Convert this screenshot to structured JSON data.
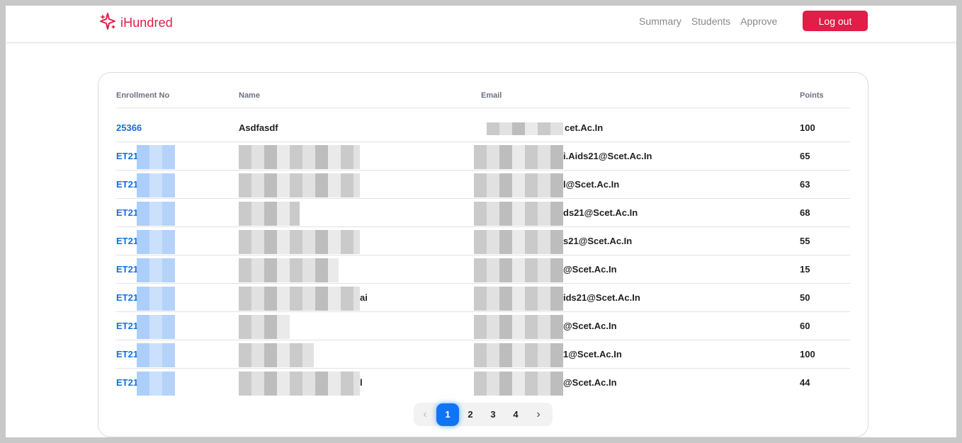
{
  "header": {
    "brand": "iHundred",
    "nav": [
      "Summary",
      "Students",
      "Approve"
    ],
    "logout_label": "Log out"
  },
  "table": {
    "headers": [
      "Enrollment No",
      "Name",
      "Email",
      "Points"
    ],
    "rows": [
      {
        "enrollment": "25366",
        "name": "Asdfasdf",
        "email": "cet.Ac.In",
        "points": "100"
      },
      {
        "enrollment": "ET21",
        "name": "",
        "email": "i.Aids21@Scet.Ac.In",
        "points": "65"
      },
      {
        "enrollment": "ET21",
        "name": "",
        "email": "l@Scet.Ac.In",
        "points": "63"
      },
      {
        "enrollment": "ET21",
        "name": "",
        "email": "ds21@Scet.Ac.In",
        "points": "68"
      },
      {
        "enrollment": "ET21",
        "name": "",
        "email": "s21@Scet.Ac.In",
        "points": "55"
      },
      {
        "enrollment": "ET21",
        "name": "",
        "email": "@Scet.Ac.In",
        "points": "15"
      },
      {
        "enrollment": "ET21",
        "name": "ai",
        "email": "ids21@Scet.Ac.In",
        "points": "50"
      },
      {
        "enrollment": "ET21",
        "name": "",
        "email": "@Scet.Ac.In",
        "points": "60"
      },
      {
        "enrollment": "ET21",
        "name": "",
        "email": "1@Scet.Ac.In",
        "points": "100"
      },
      {
        "enrollment": "ET21",
        "name": "l",
        "email": "@Scet.Ac.In",
        "points": "44"
      }
    ]
  },
  "pagination": {
    "prev": "‹",
    "pages": [
      "1",
      "2",
      "3",
      "4"
    ],
    "next": "›",
    "current": "1"
  },
  "colors": {
    "brand": "#e11d48",
    "link": "#1570d9",
    "active_page": "#0f74f5"
  }
}
